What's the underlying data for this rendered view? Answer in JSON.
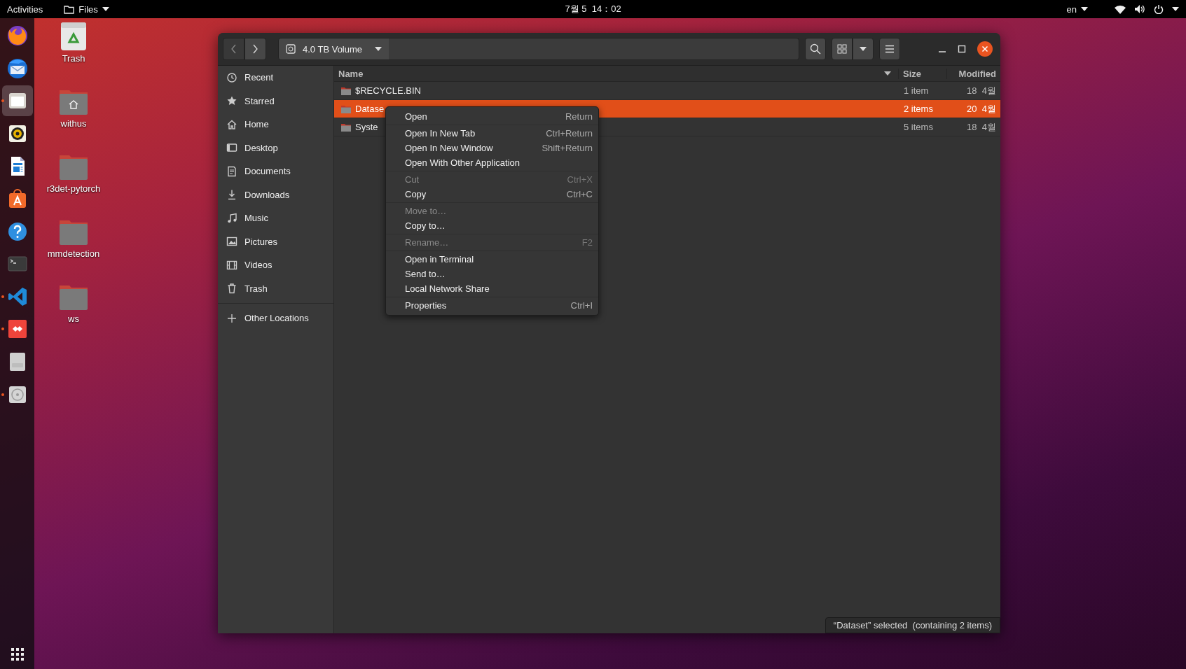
{
  "top_bar": {
    "activities": "Activities",
    "app_menu": "Files",
    "clock": "7월 5  14：02",
    "input_source": "en"
  },
  "dock": {
    "apps": [
      {
        "kind": "firefox",
        "running": false,
        "selected": false
      },
      {
        "kind": "thunderbird",
        "running": false,
        "selected": false
      },
      {
        "kind": "files",
        "running": true,
        "selected": true
      },
      {
        "kind": "rhythmbox",
        "running": false,
        "selected": false
      },
      {
        "kind": "writer",
        "running": false,
        "selected": false
      },
      {
        "kind": "software",
        "running": false,
        "selected": false
      },
      {
        "kind": "help",
        "running": false,
        "selected": false
      },
      {
        "kind": "terminal",
        "running": false,
        "selected": false
      },
      {
        "kind": "vscode",
        "running": true,
        "selected": false
      },
      {
        "kind": "anydesk",
        "running": true,
        "selected": false
      },
      {
        "kind": "ssd",
        "running": false,
        "selected": false
      },
      {
        "kind": "disc",
        "running": true,
        "selected": false
      }
    ]
  },
  "desktop_icons": [
    {
      "kind": "trash",
      "label": "Trash"
    },
    {
      "kind": "home",
      "label": "withus"
    },
    {
      "kind": "folder",
      "label": "r3det-pytorch"
    },
    {
      "kind": "folder",
      "label": "mmdetection"
    },
    {
      "kind": "folder",
      "label": "ws"
    }
  ],
  "window": {
    "navigation": [
      {
        "kind": "back",
        "disabled": true
      },
      {
        "kind": "forward",
        "disabled": false
      }
    ],
    "location": "4.0 TB Volume",
    "sidebar": {
      "items": [
        {
          "kind": "recent",
          "label": "Recent",
          "selected": false
        },
        {
          "kind": "starred",
          "label": "Starred",
          "selected": false
        },
        {
          "kind": "home",
          "label": "Home",
          "selected": false
        },
        {
          "kind": "desktop",
          "label": "Desktop",
          "selected": false
        },
        {
          "kind": "documents",
          "label": "Documents",
          "selected": false
        },
        {
          "kind": "downloads",
          "label": "Downloads",
          "selected": false
        },
        {
          "kind": "music",
          "label": "Music",
          "selected": false
        },
        {
          "kind": "pictures",
          "label": "Pictures",
          "selected": false
        },
        {
          "kind": "videos",
          "label": "Videos",
          "selected": false
        },
        {
          "kind": "trash",
          "label": "Trash",
          "selected": false
        }
      ],
      "other_locations": "Other Locations"
    },
    "file_list": {
      "columns": [
        {
          "label": "Name",
          "sorted": true
        },
        {
          "label": "Size",
          "sorted": false
        },
        {
          "label": "Modified",
          "sorted": false
        }
      ],
      "rows": [
        {
          "name": "$RECYCLE.BIN",
          "size": "1 item",
          "modified": "18  4월",
          "selected": false
        },
        {
          "name": "Datase",
          "size": "2 items",
          "modified": "20  4월",
          "selected": true
        },
        {
          "name": "Syste",
          "size": "5 items",
          "modified": "18  4월",
          "selected": false
        }
      ]
    },
    "context_menu": {
      "sections": [
        {
          "items": [
            {
              "label": "Open",
              "shortcut": "Return",
              "disabled": false
            }
          ]
        },
        {
          "items": [
            {
              "label": "Open In New Tab",
              "shortcut": "Ctrl+Return",
              "disabled": false
            },
            {
              "label": "Open In New Window",
              "shortcut": "Shift+Return",
              "disabled": false
            },
            {
              "label": "Open With Other Application",
              "disabled": false
            }
          ]
        },
        {
          "items": [
            {
              "label": "Cut",
              "shortcut": "Ctrl+X",
              "disabled": true
            },
            {
              "label": "Copy",
              "shortcut": "Ctrl+C",
              "disabled": false
            }
          ]
        },
        {
          "items": [
            {
              "label": "Move to…",
              "disabled": true
            },
            {
              "label": "Copy to…",
              "disabled": false
            }
          ]
        },
        {
          "items": [
            {
              "label": "Rename…",
              "shortcut": "F2",
              "disabled": true
            }
          ]
        },
        {
          "items": [
            {
              "label": "Open in Terminal",
              "disabled": false
            },
            {
              "label": "Send to…",
              "disabled": false
            },
            {
              "label": "Local Network Share",
              "disabled": false
            }
          ]
        },
        {
          "items": [
            {
              "label": "Properties",
              "shortcut": "Ctrl+I",
              "disabled": false
            }
          ]
        }
      ]
    },
    "status": "“Dataset” selected  (containing 2 items)"
  }
}
